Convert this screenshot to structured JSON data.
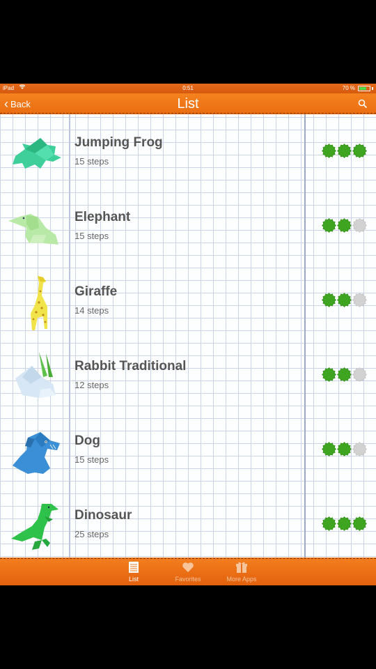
{
  "status": {
    "device": "iPad",
    "time": "0:51",
    "battery": "70 %",
    "battery_level": 0.7
  },
  "navbar": {
    "back_label": "Back",
    "title": "List",
    "search_icon": "search-icon"
  },
  "items": [
    {
      "name": "Jumping Frog",
      "steps": "15 steps",
      "difficulty": 3,
      "color": "#3ecf9a",
      "icon": "frog"
    },
    {
      "name": "Elephant",
      "steps": "15 steps",
      "difficulty": 2,
      "color": "#b9e9a6",
      "icon": "elephant"
    },
    {
      "name": "Giraffe",
      "steps": "14 steps",
      "difficulty": 2,
      "color": "#f1e34a",
      "icon": "giraffe"
    },
    {
      "name": "Rabbit Traditional",
      "steps": "12 steps",
      "difficulty": 2,
      "color": "#d7e7f5",
      "icon": "rabbit"
    },
    {
      "name": "Dog",
      "steps": "15 steps",
      "difficulty": 2,
      "color": "#3a8fd6",
      "icon": "dog"
    },
    {
      "name": "Dinosaur",
      "steps": "25 steps",
      "difficulty": 3,
      "color": "#2fc24a",
      "icon": "dinosaur"
    }
  ],
  "difficulty_max": 3,
  "colors": {
    "accent": "#ee7016",
    "dot_on": "#3fa521",
    "dot_off": "#d2d2d2"
  },
  "tabs": [
    {
      "label": "List",
      "icon": "list-icon",
      "active": true
    },
    {
      "label": "Favorites",
      "icon": "heart-icon",
      "active": false
    },
    {
      "label": "More Apps",
      "icon": "gift-icon",
      "active": false
    }
  ]
}
